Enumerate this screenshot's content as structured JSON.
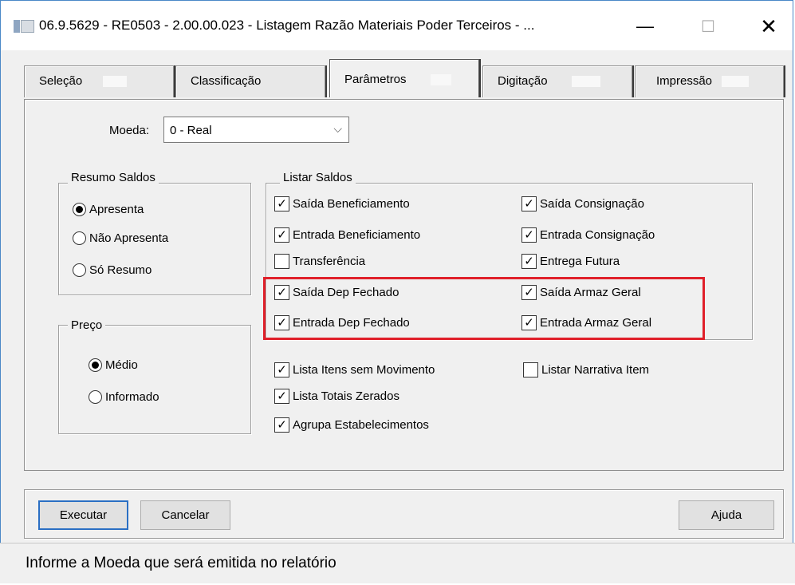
{
  "window": {
    "title": "06.9.5629 - RE0503 - 2.00.00.023 - Listagem Razão Materiais Poder Terceiros - ...",
    "min_glyph": "—",
    "max_glyph": "☐",
    "close_glyph": "✕"
  },
  "tabs": [
    {
      "label": "Seleção",
      "active": false
    },
    {
      "label": "Classificação",
      "active": false
    },
    {
      "label": "Parâmetros",
      "active": true
    },
    {
      "label": "Digitação",
      "active": false
    },
    {
      "label": "Impressão",
      "active": false
    }
  ],
  "moeda": {
    "label": "Moeda:",
    "value": "0 - Real"
  },
  "resumo_saldos": {
    "title": "Resumo Saldos",
    "options": [
      {
        "label": "Apresenta",
        "selected": true
      },
      {
        "label": "Não Apresenta",
        "selected": false
      },
      {
        "label": "Só Resumo",
        "selected": false
      }
    ]
  },
  "preco": {
    "title": "Preço",
    "options": [
      {
        "label": "Médio",
        "selected": true
      },
      {
        "label": "Informado",
        "selected": false
      }
    ]
  },
  "listar_saldos": {
    "title": "Listar Saldos",
    "left": [
      {
        "label": "Saída Beneficiamento",
        "checked": true
      },
      {
        "label": "Entrada Beneficiamento",
        "checked": true
      },
      {
        "label": "Transferência",
        "checked": false
      },
      {
        "label": "Saída Dep Fechado",
        "checked": true
      },
      {
        "label": "Entrada Dep Fechado",
        "checked": true
      }
    ],
    "right": [
      {
        "label": "Saída Consignação",
        "checked": true
      },
      {
        "label": "Entrada Consignação",
        "checked": true
      },
      {
        "label": "Entrega Futura",
        "checked": true
      },
      {
        "label": "Saída Armaz Geral",
        "checked": true
      },
      {
        "label": "Entrada Armaz Geral",
        "checked": true
      }
    ]
  },
  "extra_options": [
    {
      "label": "Lista Itens sem Movimento",
      "checked": true
    },
    {
      "label": "Lista Totais Zerados",
      "checked": true
    },
    {
      "label": "Agrupa Estabelecimentos",
      "checked": true
    },
    {
      "label": "Listar Narrativa Item",
      "checked": false
    }
  ],
  "check_glyph": "✓",
  "chevron_glyph": "⌵",
  "buttons": {
    "execute": "Executar",
    "cancel": "Cancelar",
    "help": "Ajuda"
  },
  "status_text": "Informe a Moeda que será emitida no relatório",
  "colors": {
    "highlight": "#e0202a",
    "default_button_border": "#2a6fc4"
  }
}
